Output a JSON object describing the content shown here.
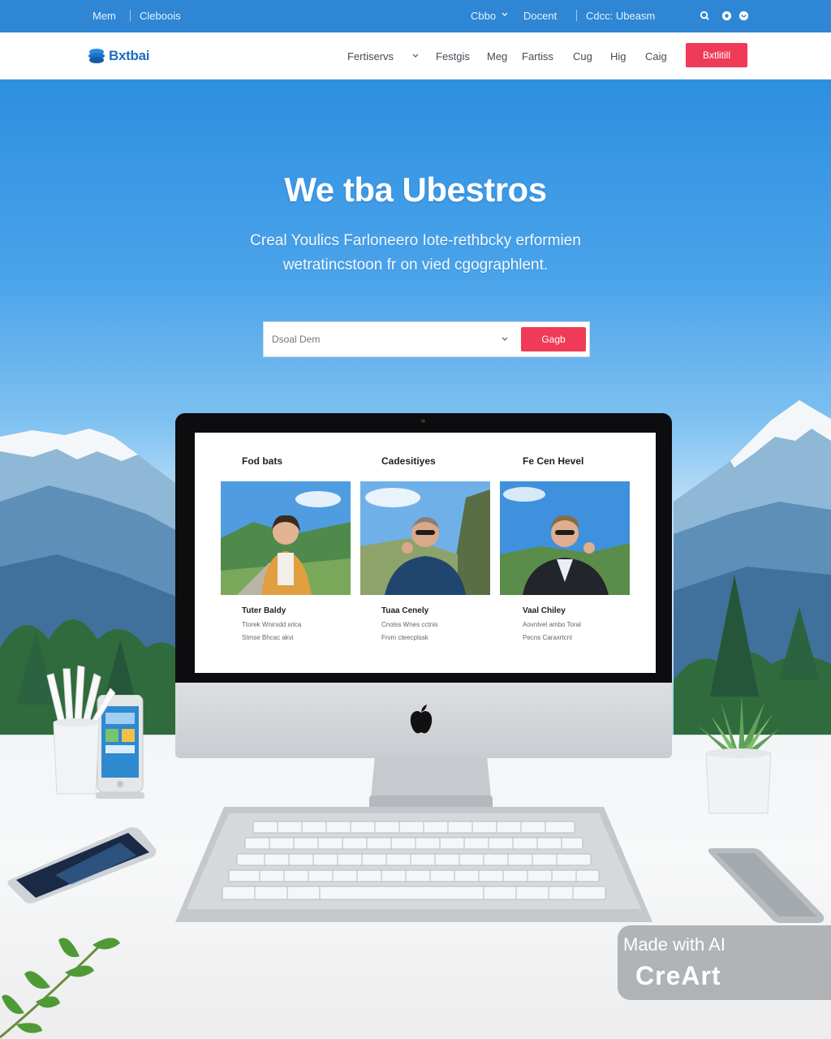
{
  "topbar": {
    "left_links": [
      "Mem",
      "Cleboois"
    ],
    "right_links": [
      "Cbbo",
      "Docent",
      "Cdcc: Ubeasm"
    ],
    "icons": [
      "search-icon",
      "globe-icon",
      "user-icon"
    ]
  },
  "navbar": {
    "logo_text": "Bxtbai",
    "items": [
      "Fertiservs",
      "Festgis",
      "Meg",
      "Fartiss",
      "Cug",
      "Hig",
      "Caig"
    ],
    "cta_label": "Bxtlitill"
  },
  "hero": {
    "title": "We tba Ubestros",
    "subtitle_lines": [
      "Creal Youlics Farloneero Iote-rethbcky erformien",
      "wetratincstoon fr on vied cgographlent."
    ],
    "search_placeholder": "Dsoal Dem",
    "search_button": "Gagb"
  },
  "monitor": {
    "cards": [
      {
        "title": "Fod bats",
        "name": "Tuter Baldy",
        "lines": [
          "Ttorek Wnirsdd srlca",
          "Stmse Bhcac akvi"
        ]
      },
      {
        "title": "Cadesitiyes",
        "name": "Tuaa Cenely",
        "lines": [
          "Cnolss Wnes cctnis",
          "Frvm cteecplssk"
        ]
      },
      {
        "title": "Fe Cen Hevel",
        "name": "Vaal Chiley",
        "lines": [
          "Aovnlvel ambo Toral",
          "Pecns Caraxrtcnl"
        ]
      }
    ]
  },
  "watermark": {
    "line1": "Made with AI",
    "line2": "CreArt"
  },
  "colors": {
    "topbar": "#2f86d4",
    "accent": "#ef3b57",
    "sky": "#4aa3ea",
    "logo": "#1e6cc0"
  }
}
